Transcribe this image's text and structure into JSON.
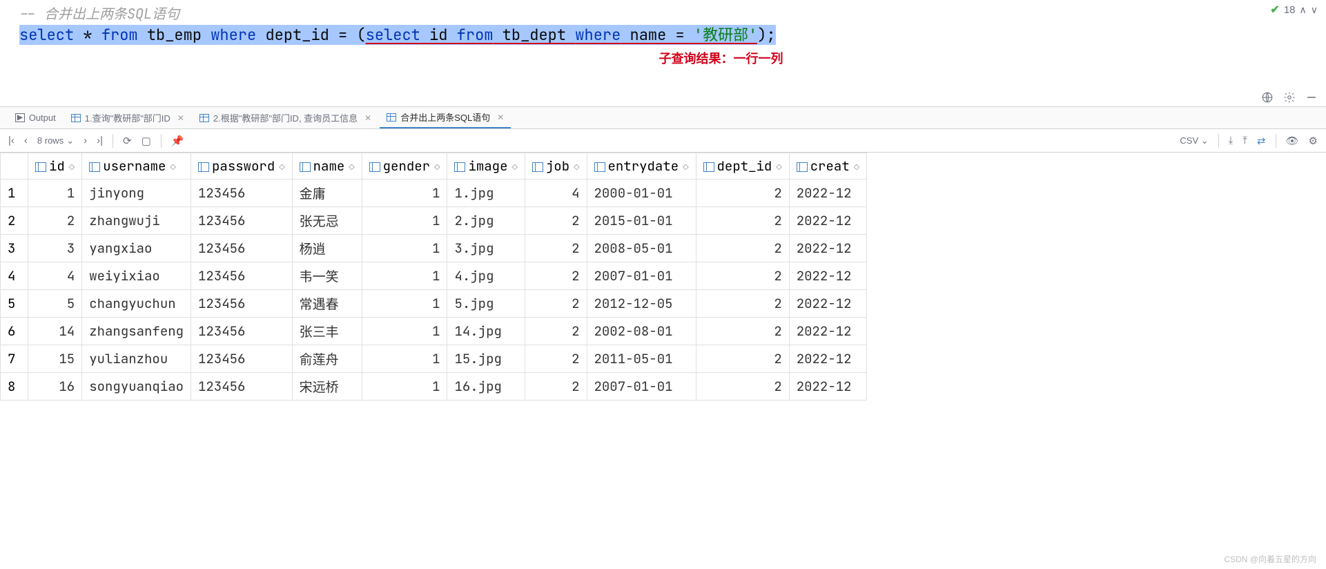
{
  "editor": {
    "comment_prefix": "-- ",
    "comment_text": "合并出上两条SQL语句",
    "sql_tokens": [
      {
        "t": "select",
        "cls": "kw-blue sel"
      },
      {
        "t": " * ",
        "cls": "tok-plain sel"
      },
      {
        "t": "from",
        "cls": "kw-blue sel"
      },
      {
        "t": " tb_emp ",
        "cls": "tok-plain sel"
      },
      {
        "t": "where",
        "cls": "kw-blue sel"
      },
      {
        "t": " dept_id = (",
        "cls": "tok-plain sel"
      },
      {
        "t": "select",
        "cls": "kw-blue sel subq"
      },
      {
        "t": " id ",
        "cls": "tok-plain sel subq"
      },
      {
        "t": "from",
        "cls": "kw-blue sel subq"
      },
      {
        "t": " tb_dept ",
        "cls": "tok-plain sel subq"
      },
      {
        "t": "where",
        "cls": "kw-blue sel subq"
      },
      {
        "t": " name = ",
        "cls": "tok-plain sel subq"
      },
      {
        "t": "'教研部'",
        "cls": "tok-str sel subq"
      },
      {
        "t": ");",
        "cls": "tok-plain sel"
      }
    ],
    "annotation": "子查询结果：一行一列",
    "problem_count": "18"
  },
  "tabs": {
    "output": "Output",
    "t1": "1.查询\"教研部\"部门ID",
    "t2": "2.根据\"教研部\"部门ID, 查询员工信息",
    "t3": "合并出上两条SQL语句"
  },
  "toolbar": {
    "row_info": "8 rows",
    "export_format": "CSV"
  },
  "table": {
    "columns": [
      "id",
      "username",
      "password",
      "name",
      "gender",
      "image",
      "job",
      "entrydate",
      "dept_id",
      "creat"
    ],
    "rows": [
      {
        "n": "1",
        "id": "1",
        "username": "jinyong",
        "password": "123456",
        "name": "金庸",
        "gender": "1",
        "image": "1.jpg",
        "job": "4",
        "entrydate": "2000-01-01",
        "dept_id": "2",
        "creat": "2022-12"
      },
      {
        "n": "2",
        "id": "2",
        "username": "zhangwuji",
        "password": "123456",
        "name": "张无忌",
        "gender": "1",
        "image": "2.jpg",
        "job": "2",
        "entrydate": "2015-01-01",
        "dept_id": "2",
        "creat": "2022-12"
      },
      {
        "n": "3",
        "id": "3",
        "username": "yangxiao",
        "password": "123456",
        "name": "杨逍",
        "gender": "1",
        "image": "3.jpg",
        "job": "2",
        "entrydate": "2008-05-01",
        "dept_id": "2",
        "creat": "2022-12"
      },
      {
        "n": "4",
        "id": "4",
        "username": "weiyixiao",
        "password": "123456",
        "name": "韦一笑",
        "gender": "1",
        "image": "4.jpg",
        "job": "2",
        "entrydate": "2007-01-01",
        "dept_id": "2",
        "creat": "2022-12"
      },
      {
        "n": "5",
        "id": "5",
        "username": "changyuchun",
        "password": "123456",
        "name": "常遇春",
        "gender": "1",
        "image": "5.jpg",
        "job": "2",
        "entrydate": "2012-12-05",
        "dept_id": "2",
        "creat": "2022-12"
      },
      {
        "n": "6",
        "id": "14",
        "username": "zhangsanfeng",
        "password": "123456",
        "name": "张三丰",
        "gender": "1",
        "image": "14.jpg",
        "job": "2",
        "entrydate": "2002-08-01",
        "dept_id": "2",
        "creat": "2022-12"
      },
      {
        "n": "7",
        "id": "15",
        "username": "yulianzhou",
        "password": "123456",
        "name": "俞莲舟",
        "gender": "1",
        "image": "15.jpg",
        "job": "2",
        "entrydate": "2011-05-01",
        "dept_id": "2",
        "creat": "2022-12"
      },
      {
        "n": "8",
        "id": "16",
        "username": "songyuanqiao",
        "password": "123456",
        "name": "宋远桥",
        "gender": "1",
        "image": "16.jpg",
        "job": "2",
        "entrydate": "2007-01-01",
        "dept_id": "2",
        "creat": "2022-12"
      }
    ]
  },
  "watermark": "CSDN @向着五星的方向"
}
